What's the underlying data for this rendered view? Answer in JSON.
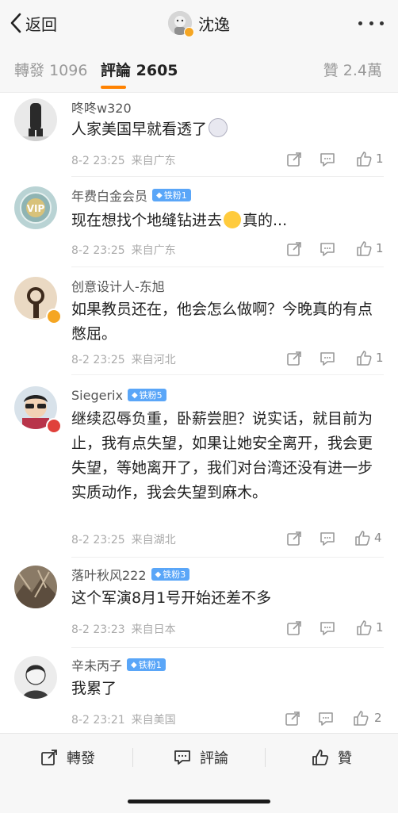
{
  "header": {
    "back_label": "返回",
    "title": "沈逸"
  },
  "tabs": {
    "reposts_label": "轉發",
    "reposts_count": "1096",
    "comments_label": "評論",
    "comments_count": "2605",
    "likes_label": "贊",
    "likes_count": "2.4萬"
  },
  "comments": [
    {
      "name": "咚咚w320",
      "badge": "",
      "text_before": "人家美国早就看透了",
      "text_after": "",
      "emoji": "emoji-husky-icon",
      "time": "8-2 23:25",
      "source": "来自广东",
      "likes": "1"
    },
    {
      "name": "年费白金会员",
      "badge": "铁粉1",
      "text_before": "现在想找个地缝钻进去",
      "text_after": "真的...",
      "emoji": "emoji-tongue-face-icon",
      "time": "8-2 23:25",
      "source": "来自广东",
      "likes": "1"
    },
    {
      "name": "创意设计人-东旭",
      "badge": "",
      "text_before": "如果教员还在，他会怎么做啊？今晚真的有点憋屈。",
      "text_after": "",
      "time": "8-2 23:25",
      "source": "来自河北",
      "likes": "1"
    },
    {
      "name": "Siegerix",
      "badge": "铁粉5",
      "text_before": "继续忍辱负重，卧薪尝胆？说实话，就目前为止，我有点失望，如果让她安全离开，我会更失望，等她离开了，我们对台湾还没有进一步实质动作，我会失望到麻木。",
      "text_after": "",
      "time": "8-2 23:25",
      "source": "来自湖北",
      "likes": "4"
    },
    {
      "name": "落叶秋风222",
      "badge": "铁粉3",
      "text_before": "这个军演8月1号开始还差不多",
      "text_after": "",
      "time": "8-2 23:23",
      "source": "来自日本",
      "likes": "1"
    },
    {
      "name": "辛未丙子",
      "badge": "铁粉1",
      "text_before": "我累了",
      "text_after": "",
      "time": "8-2 23:21",
      "source": "来自美国",
      "likes": "2"
    }
  ],
  "bottom": {
    "repost_label": "轉發",
    "comment_label": "評論",
    "like_label": "贊"
  },
  "colors": {
    "accent": "#ff8200",
    "fan_badge": "#5aa6f8",
    "verified_badge": "#f5a623"
  }
}
